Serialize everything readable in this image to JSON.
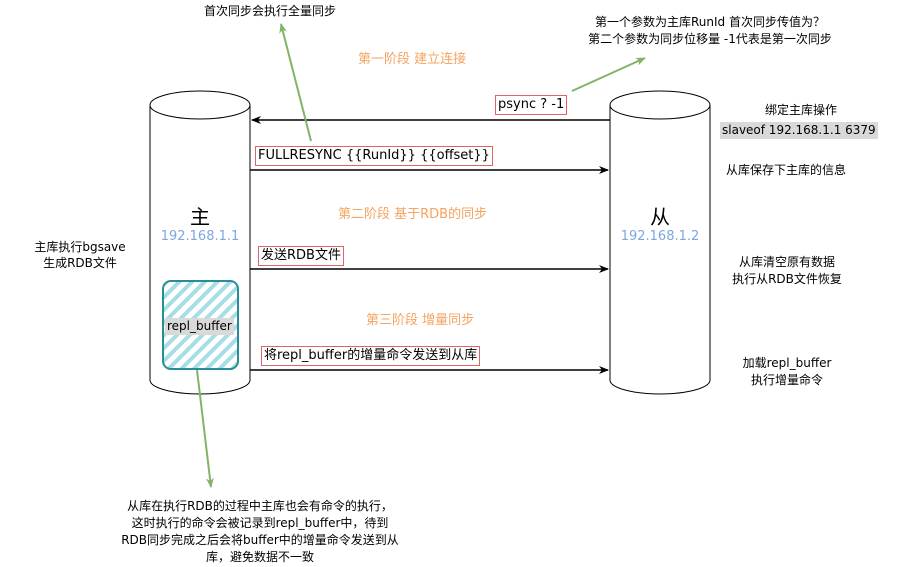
{
  "master": {
    "title": "主",
    "ip": "192.168.1.1",
    "buffer_label": "repl_buffer"
  },
  "slave": {
    "title": "从",
    "ip": "192.168.1.2"
  },
  "phases": {
    "p1": "第一阶段 建立连接",
    "p2": "第二阶段 基于RDB的同步",
    "p3": "第三阶段 增量同步"
  },
  "messages": {
    "psync": "psync   ?   -1",
    "fullresync": "FULLRESYNC {{RunId}}  {{offset}}",
    "send_rdb": "发送RDB文件",
    "send_buffer": "将repl_buffer的增量命令发送到从库"
  },
  "notes": {
    "top": "首次同步会执行全量同步",
    "psync_line1": "第一个参数为主库RunId  首次同步传值为？",
    "psync_line2": "第二个参数为同步位移量  -1代表是第一次同步",
    "bind_title": "绑定主库操作",
    "bind_cmd": "slaveof 192.168.1.1 6379",
    "save_master": "从库保存下主库的信息",
    "bgsave_line1": "主库执行bgsave",
    "bgsave_line2": "生成RDB文件",
    "clear_line1": "从库清空原有数据",
    "clear_line2": "执行从RDB文件恢复",
    "load_line1": "加载repl_buffer",
    "load_line2": "执行增量命令",
    "bottom_line1": "从库在执行RDB的过程中主库也会有命令的执行，",
    "bottom_line2": "这时执行的命令会被记录到repl_buffer中，待到",
    "bottom_line3": "RDB同步完成之后会将buffer中的增量命令发送到从",
    "bottom_line4": "库，避免数据不一致"
  },
  "colors": {
    "phase": "#F4A460",
    "ip": "#7EA6E0",
    "callout_arrow": "#82B366",
    "buffer_fill": "#A6DDE6",
    "buffer_stroke": "#2A8C96",
    "box_border": "#E06666"
  }
}
